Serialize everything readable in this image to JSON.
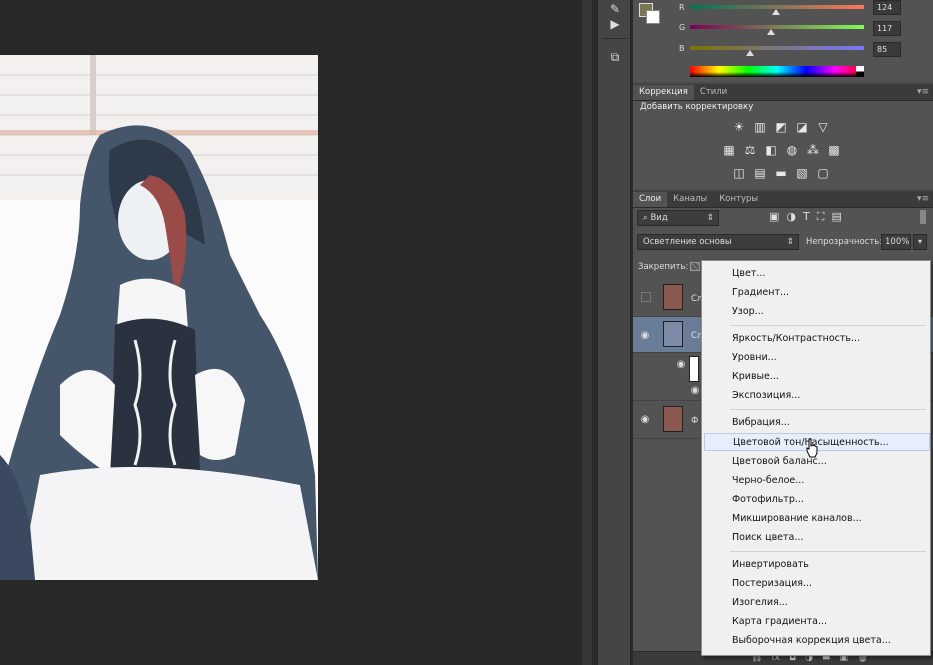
{
  "color_panel": {
    "sliders": [
      {
        "label": "R",
        "value": "124",
        "fraction": 0.49
      },
      {
        "label": "G",
        "value": "117",
        "fraction": 0.46
      },
      {
        "label": "B",
        "value": "85",
        "fraction": 0.33
      }
    ],
    "foreground_color": "#7c7555",
    "background_color": "#ffffff"
  },
  "adjustments_panel": {
    "tabs": [
      "Коррекция",
      "Стили"
    ],
    "title": "Добавить корректировку",
    "icon_rows": [
      [
        "brightness-icon",
        "levels-icon",
        "curves-icon",
        "exposure-icon",
        "vibrance-icon"
      ],
      [
        "hue-saturation-icon",
        "color-balance-icon",
        "black-white-icon",
        "photo-filter-icon",
        "channel-mixer-icon",
        "color-lookup-icon"
      ],
      [
        "invert-icon",
        "posterize-icon",
        "threshold-icon",
        "gradient-map-icon",
        "selective-color-icon"
      ]
    ]
  },
  "layers_panel": {
    "tabs": [
      "Слои",
      "Каналы",
      "Контуры"
    ],
    "filter_label": "Вид",
    "blend_mode": "Осветление основы",
    "opacity_label": "Непрозрачность:",
    "opacity_value": "100%",
    "lock_label": "Закрепить:",
    "layers": [
      {
        "name": "Сл",
        "visible": false,
        "selected": false
      },
      {
        "name": "Сл",
        "visible": true,
        "selected": true
      },
      {
        "name": "Ф",
        "visible": true,
        "selected": false
      }
    ]
  },
  "context_menu": {
    "groups": [
      [
        "Цвет...",
        "Градиент...",
        "Узор..."
      ],
      [
        "Яркость/Контрастность...",
        "Уровни...",
        "Кривые...",
        "Экспозиция..."
      ],
      [
        "Вибрация...",
        "Цветовой тон/Насыщенность...",
        "Цветовой баланс...",
        "Черно-белое...",
        "Фотофильтр...",
        "Микширование каналов...",
        "Поиск цвета..."
      ],
      [
        "Инвертировать",
        "Постеризация...",
        "Изогелия...",
        "Карта градиента...",
        "Выборочная коррекция цвета..."
      ]
    ],
    "highlighted": "Цветовой тон/Насыщенность..."
  },
  "bottom_bar": {
    "fx_label": "fx"
  }
}
